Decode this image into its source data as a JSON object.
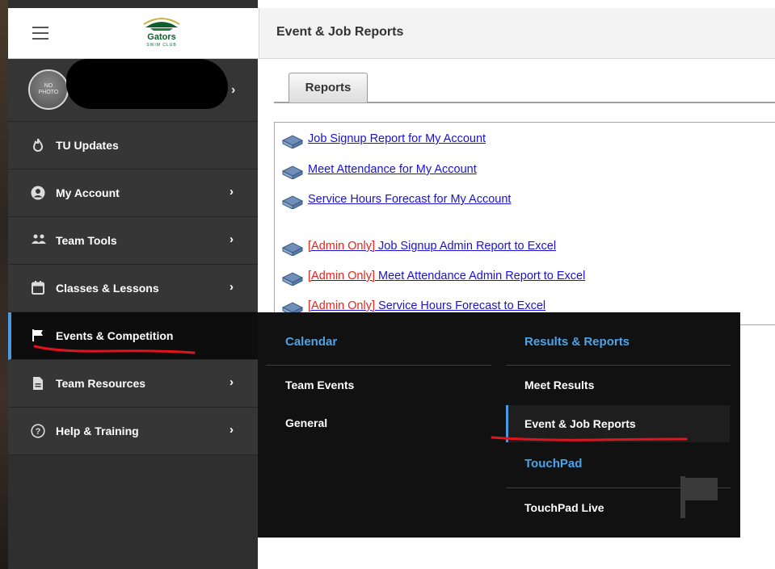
{
  "app": {
    "logo_text": "Gators",
    "logo_subtext": "SWIM CLUB",
    "page_title": "Event & Job Reports"
  },
  "profile": {
    "avatar_text": "NO PHOTO"
  },
  "sidebar": {
    "items": [
      {
        "label": "TU Updates",
        "icon": "fire-icon"
      },
      {
        "label": "My Account",
        "icon": "user-circle-icon"
      },
      {
        "label": "Team Tools",
        "icon": "people-icon"
      },
      {
        "label": "Classes & Lessons",
        "icon": "calendar-icon"
      },
      {
        "label": "Events & Competition",
        "icon": "flag-icon",
        "active": true
      },
      {
        "label": "Team Resources",
        "icon": "document-icon"
      },
      {
        "label": "Help & Training",
        "icon": "help-icon"
      }
    ]
  },
  "tabs": [
    {
      "label": "Reports",
      "active": true
    }
  ],
  "reports": {
    "user": [
      {
        "text": "Job Signup Report for My Account"
      },
      {
        "text": "Meet Attendance for My Account"
      },
      {
        "text": "Service Hours Forecast for My Account"
      }
    ],
    "admin": [
      {
        "tag": "[Admin Only]",
        "text": " Job Signup Admin Report to Excel"
      },
      {
        "tag": "[Admin Only]",
        "text": " Meet Attendance Admin Report to Excel"
      },
      {
        "tag": "[Admin Only]",
        "text": " Service Hours Forecast to Excel"
      }
    ]
  },
  "flyout": {
    "calendar": {
      "heading": "Calendar",
      "items": [
        "Team Events",
        "General"
      ]
    },
    "results": {
      "heading": "Results & Reports",
      "items": [
        "Meet Results",
        "Event & Job Reports"
      ]
    },
    "touchpad": {
      "heading": "TouchPad",
      "items": [
        "TouchPad Live"
      ]
    }
  },
  "colors": {
    "accent": "#4a9ae0",
    "link": "#1a12d4",
    "admin_tag": "#e8241c",
    "sidebar_bg": "#363636",
    "flyout_bg": "#111111",
    "annotation": "#e0141e"
  }
}
